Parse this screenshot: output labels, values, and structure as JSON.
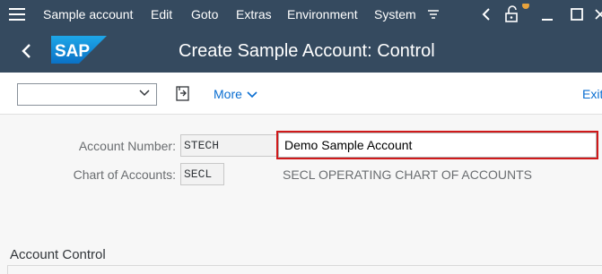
{
  "menu": {
    "items": [
      {
        "label": "Sample account"
      },
      {
        "label": "Edit"
      },
      {
        "label": "Goto"
      },
      {
        "label": "Extras"
      },
      {
        "label": "Environment"
      },
      {
        "label": "System"
      }
    ],
    "icons": [
      "menu-more-icon",
      "chevron-left-icon",
      "lock-icon",
      "minimize-icon",
      "maximize-icon"
    ]
  },
  "titlebar": {
    "logo_text": "SAP",
    "title": "Create Sample Account: Control"
  },
  "toolbar": {
    "more_label": "More",
    "exit_label": "Exit"
  },
  "form": {
    "account_number_label": "Account Number:",
    "account_number_value": "STECH",
    "description_value": "Demo Sample Account",
    "chart_of_accounts_label": "Chart of Accounts:",
    "chart_of_accounts_value": "SECL",
    "chart_of_accounts_desc": "SECL OPERATING CHART OF ACCOUNTS"
  },
  "section": {
    "title": "Account Control"
  },
  "colors": {
    "shell": "#354a5f",
    "link": "#0a6ed1",
    "highlight": "#d0191a"
  }
}
